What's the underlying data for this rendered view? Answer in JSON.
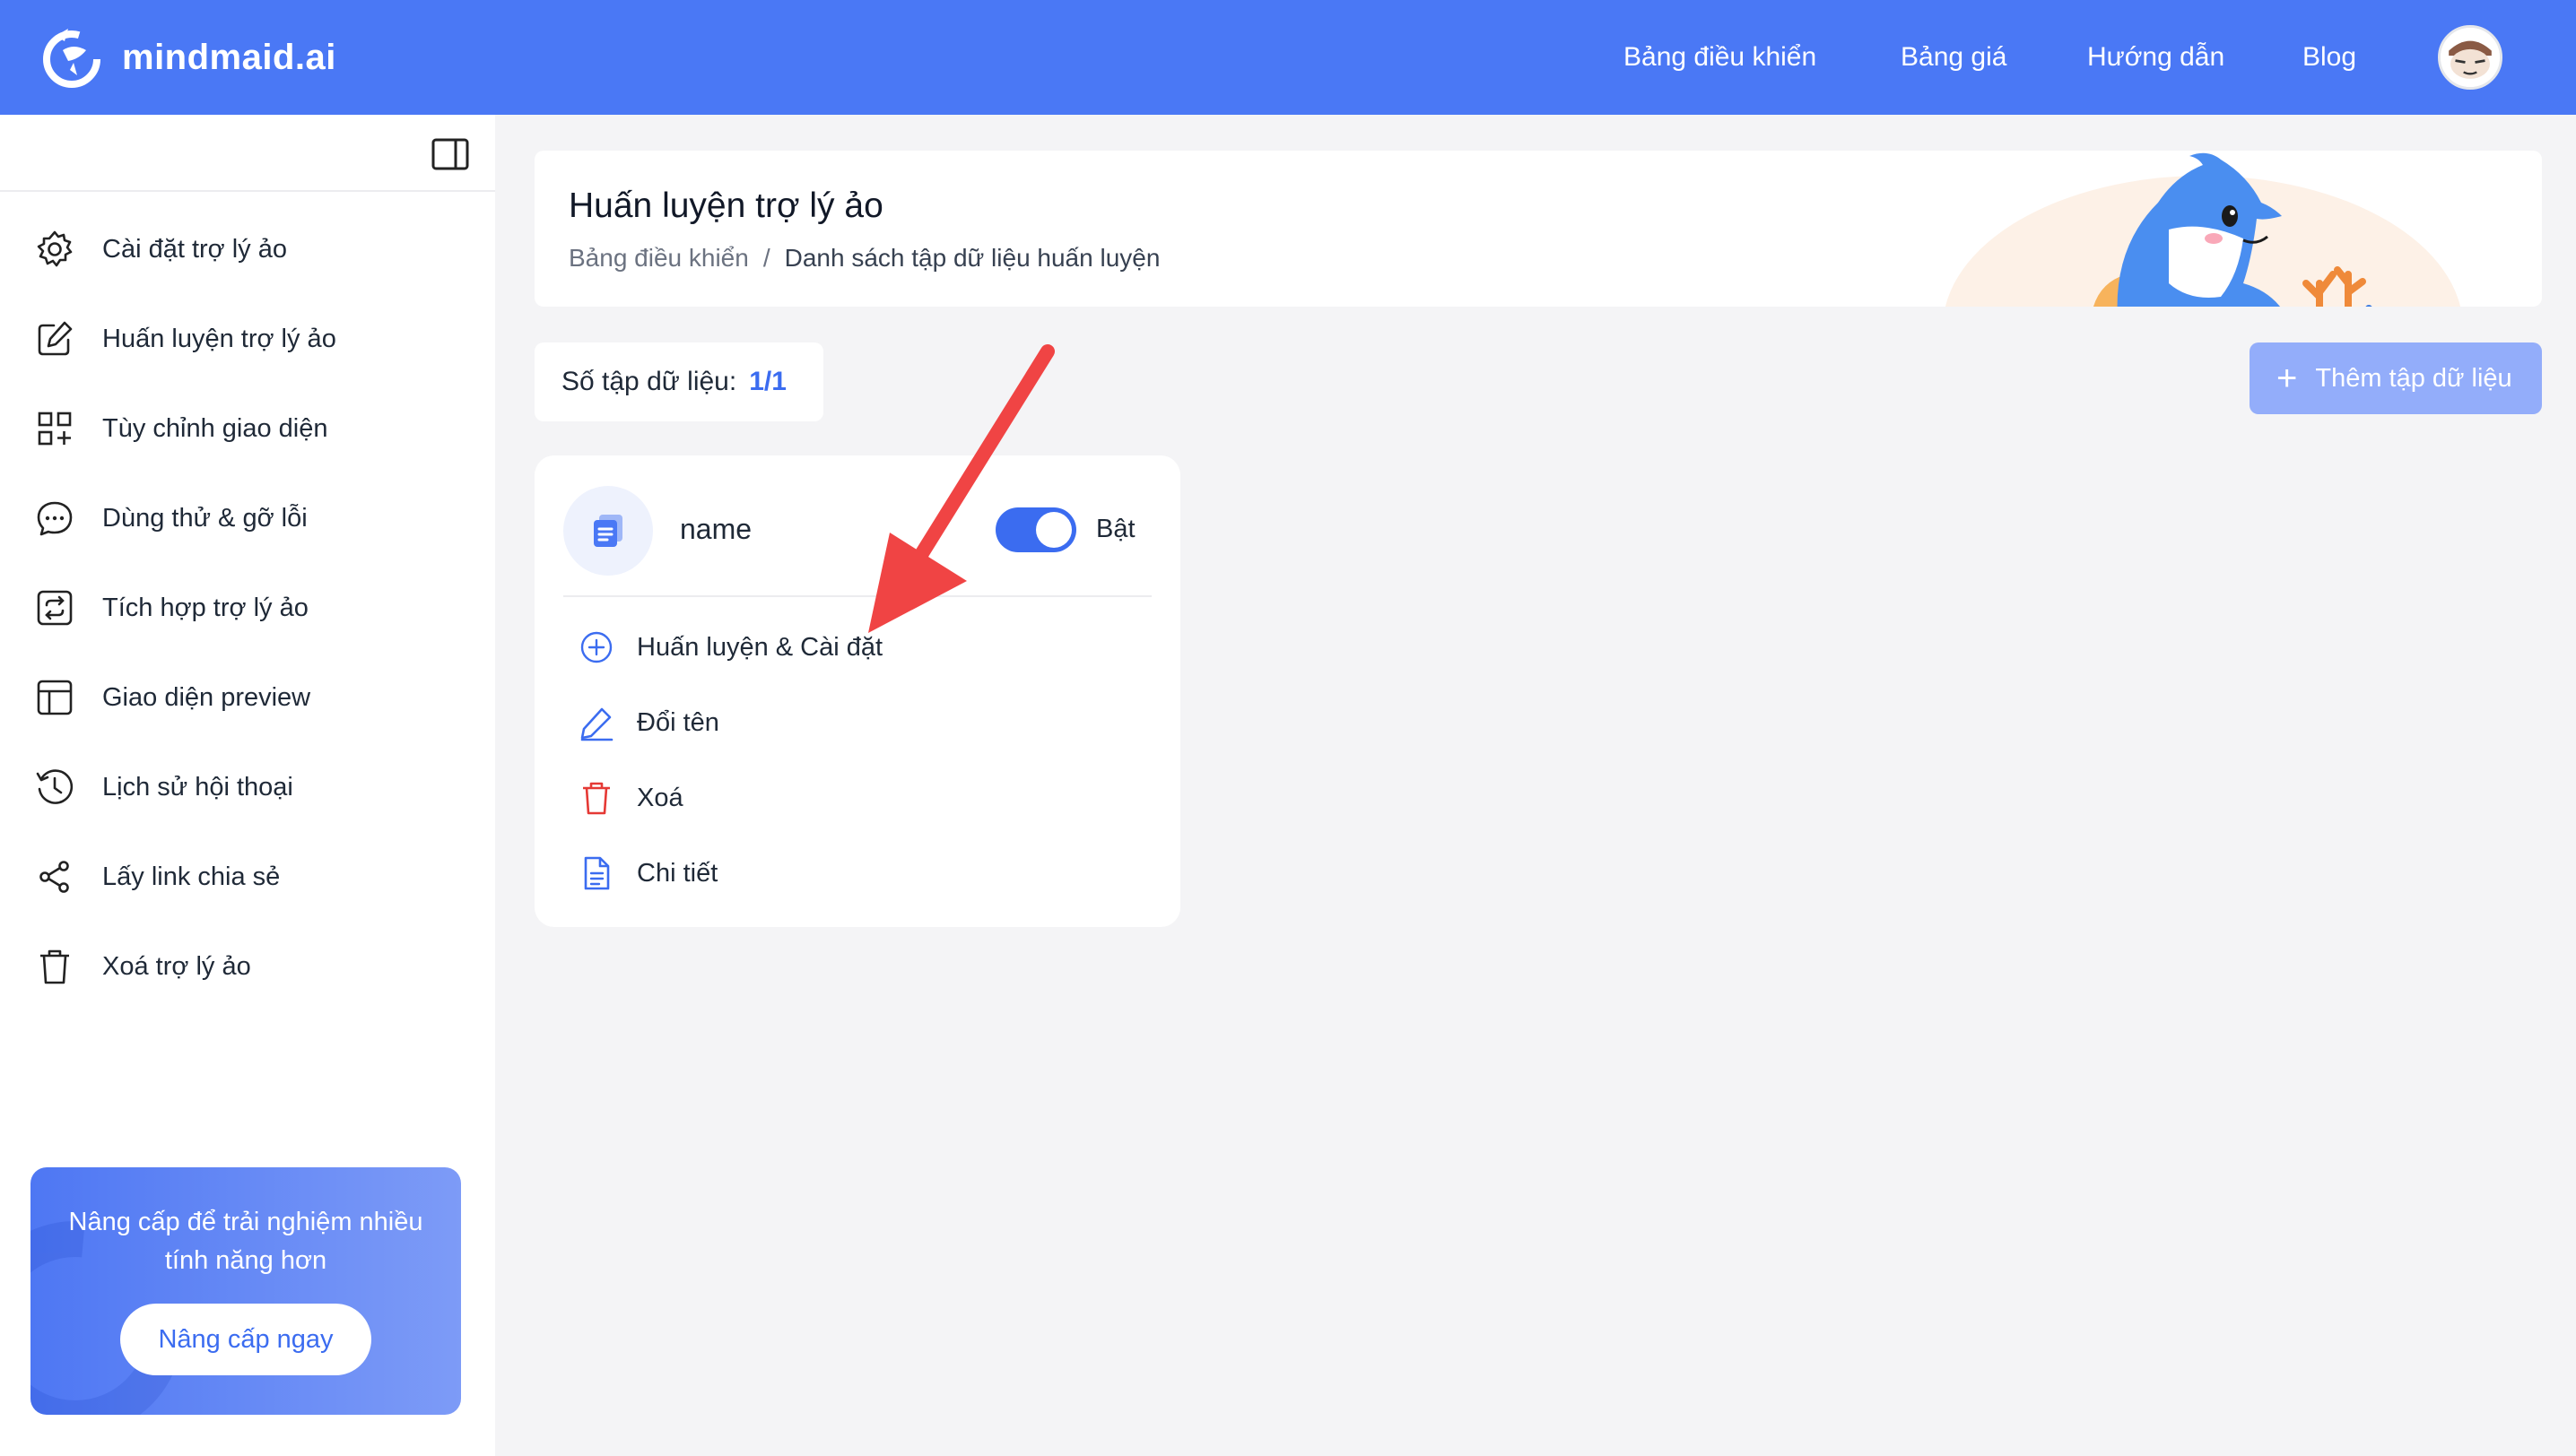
{
  "brand": {
    "name": "mindmaid.ai"
  },
  "topnav": [
    {
      "label": "Bảng điều khiển"
    },
    {
      "label": "Bảng giá"
    },
    {
      "label": "Hướng dẫn"
    },
    {
      "label": "Blog"
    }
  ],
  "sidebar": {
    "items": [
      {
        "label": "Cài đặt trợ lý ảo",
        "icon": "gear-icon"
      },
      {
        "label": "Huấn luyện trợ lý ảo",
        "icon": "edit-icon"
      },
      {
        "label": "Tùy chỉnh giao diện",
        "icon": "grid-add-icon"
      },
      {
        "label": "Dùng thử & gỡ lỗi",
        "icon": "chat-bubble-icon"
      },
      {
        "label": "Tích hợp trợ lý ảo",
        "icon": "integration-icon"
      },
      {
        "label": "Giao diện preview",
        "icon": "layout-icon"
      },
      {
        "label": "Lịch sử hội thoại",
        "icon": "history-icon"
      },
      {
        "label": "Lấy link chia sẻ",
        "icon": "share-icon"
      },
      {
        "label": "Xoá trợ lý ảo",
        "icon": "trash-icon"
      }
    ],
    "upgrade": {
      "text": "Nâng cấp để trải nghiệm nhiều tính năng hơn",
      "button": "Nâng cấp ngay"
    }
  },
  "header": {
    "title": "Huấn luyện trợ lý ảo",
    "breadcrumb": [
      "Bảng điều khiển",
      "/",
      "Danh sách tập dữ liệu huấn luyện"
    ]
  },
  "dataset_count": {
    "label": "Số tập dữ liệu:",
    "value": "1/1"
  },
  "add_button": {
    "label": "Thêm tập dữ liệu"
  },
  "dataset": {
    "name": "name",
    "toggle_label": "Bật",
    "enabled": true,
    "actions": [
      {
        "label": "Huấn luyện & Cài đặt",
        "icon": "plus-circle-icon"
      },
      {
        "label": "Đổi tên",
        "icon": "pencil-icon"
      },
      {
        "label": "Xoá",
        "icon": "trash-icon"
      },
      {
        "label": "Chi tiết",
        "icon": "document-icon"
      }
    ]
  },
  "colors": {
    "topbar": "#4a78f5",
    "accent": "#3b6cf0",
    "danger": "#e53935",
    "annotation_arrow": "#f04444"
  }
}
